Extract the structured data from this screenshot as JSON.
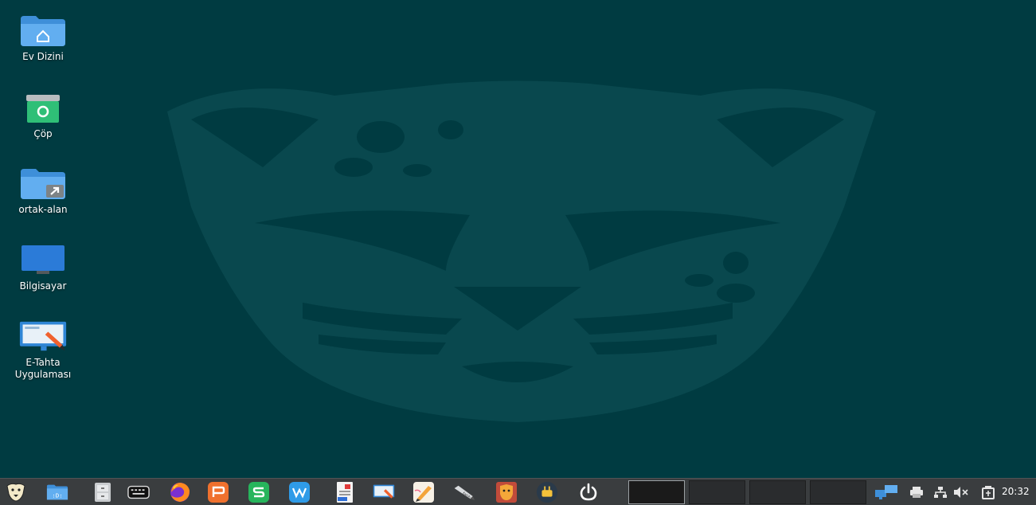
{
  "desktop": {
    "icons": [
      {
        "label": "Ev Dizini",
        "icon": "home-folder-icon"
      },
      {
        "label": "Çöp",
        "icon": "trash-icon"
      },
      {
        "label": "ortak-alan",
        "icon": "shared-folder-icon"
      },
      {
        "label": "Bilgisayar",
        "icon": "computer-icon"
      },
      {
        "label_line1": "E-Tahta",
        "label_line2": "Uygulaması",
        "icon": "e-tahta-icon"
      }
    ],
    "background_color": "#003b41",
    "wallpaper": "pardus-leopard-logo"
  },
  "taskbar": {
    "launchers": [
      {
        "name": "pardus-menu-icon"
      },
      {
        "name": "file-manager-icon"
      },
      {
        "name": "file-cabinet-icon"
      },
      {
        "name": "keyboard-icon"
      },
      {
        "name": "firefox-icon"
      },
      {
        "name": "presentation-app-icon"
      },
      {
        "name": "spreadsheet-app-icon"
      },
      {
        "name": "writer-app-icon"
      },
      {
        "name": "document-viewer-icon"
      },
      {
        "name": "e-tahta-taskbar-icon"
      },
      {
        "name": "drawing-app-icon"
      },
      {
        "name": "fatih-pen-icon"
      },
      {
        "name": "pardus-lion-icon"
      },
      {
        "name": "eta-tools-icon"
      },
      {
        "name": "power-icon"
      }
    ],
    "workspaces_count": 4,
    "active_workspace": 1,
    "tray": [
      "network-displays-icon",
      "printer-icon",
      "network-icon",
      "volume-muted-icon",
      "battery-icon"
    ],
    "clock": "20:32"
  }
}
